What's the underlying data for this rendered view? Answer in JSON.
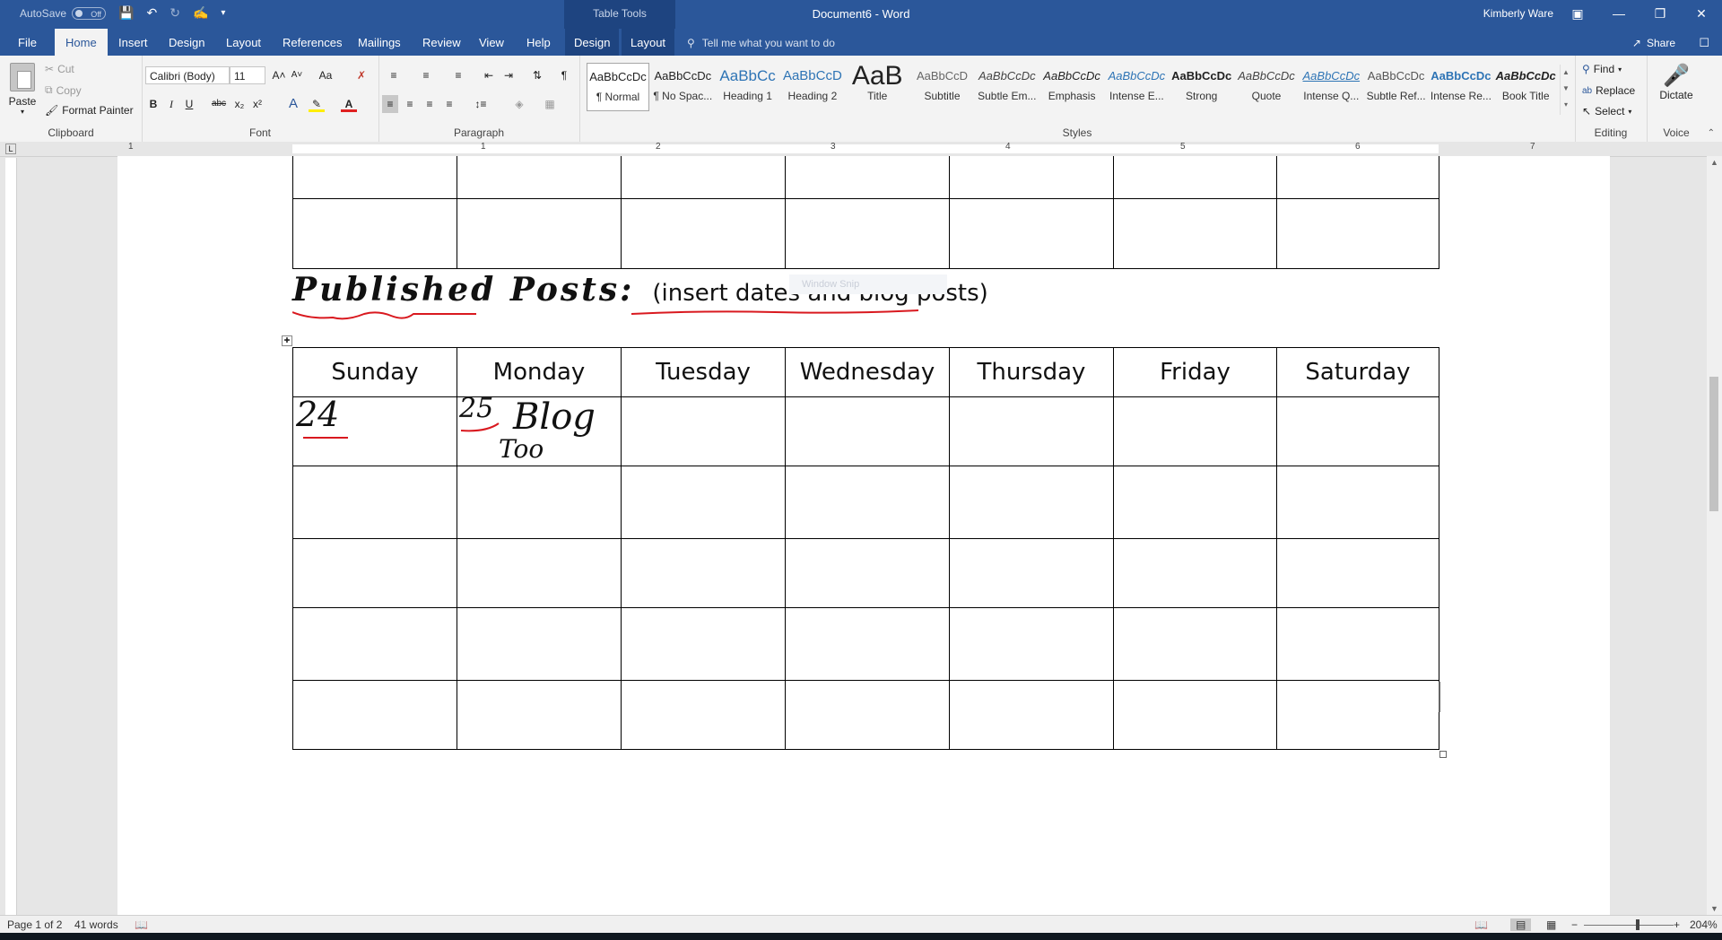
{
  "titlebar": {
    "autosave_label": "AutoSave",
    "autosave_state": "Off",
    "contextual_tab_group": "Table Tools",
    "document_title": "Document6  -  Word",
    "user_name": "Kimberly Ware"
  },
  "tabs": {
    "file": "File",
    "home": "Home",
    "insert": "Insert",
    "design": "Design",
    "layout": "Layout",
    "references": "References",
    "mailings": "Mailings",
    "review": "Review",
    "view": "View",
    "help": "Help",
    "table_design": "Design",
    "table_layout": "Layout",
    "tell_me": "Tell me what you want to do",
    "share": "Share"
  },
  "clipboard": {
    "paste": "Paste",
    "cut": "Cut",
    "copy": "Copy",
    "format_painter": "Format Painter",
    "group_label": "Clipboard"
  },
  "font": {
    "family": "Calibri (Body)",
    "size": "11",
    "bold": "B",
    "italic": "I",
    "underline": "U",
    "strike": "abc",
    "subscript": "x₂",
    "superscript": "x²",
    "change_case": "Aa",
    "group_label": "Font"
  },
  "paragraph": {
    "group_label": "Paragraph"
  },
  "styles": {
    "items": [
      {
        "sample": "AaBbCcDc",
        "name": "¶ Normal"
      },
      {
        "sample": "AaBbCcDc",
        "name": "¶ No Spac..."
      },
      {
        "sample": "AaBbCc",
        "name": "Heading 1"
      },
      {
        "sample": "AaBbCcD",
        "name": "Heading 2"
      },
      {
        "sample": "AaB",
        "name": "Title"
      },
      {
        "sample": "AaBbCcD",
        "name": "Subtitle"
      },
      {
        "sample": "AaBbCcDc",
        "name": "Subtle Em..."
      },
      {
        "sample": "AaBbCcDc",
        "name": "Emphasis"
      },
      {
        "sample": "AaBbCcDc",
        "name": "Intense E..."
      },
      {
        "sample": "AaBbCcDc",
        "name": "Strong"
      },
      {
        "sample": "AaBbCcDc",
        "name": "Quote"
      },
      {
        "sample": "AaBbCcDc",
        "name": "Intense Q..."
      },
      {
        "sample": "AaBbCcDc",
        "name": "Subtle Ref..."
      },
      {
        "sample": "AaBbCcDc",
        "name": "Intense Re..."
      },
      {
        "sample": "AaBbCcDc",
        "name": "Book Title"
      }
    ],
    "group_label": "Styles"
  },
  "editing": {
    "find": "Find",
    "replace": "Replace",
    "select": "Select",
    "group_label": "Editing"
  },
  "voice": {
    "dictate": "Dictate",
    "group_label": "Voice"
  },
  "ruler": {
    "numbers": [
      "1",
      "1",
      "2",
      "3",
      "4",
      "5",
      "6",
      "7"
    ]
  },
  "document": {
    "heading": "Published Posts:",
    "heading_note": "(insert dates and blog posts)",
    "window_snip": "Window Snip",
    "days": [
      "Sunday",
      "Monday",
      "Tuesday",
      "Wednesday",
      "Thursday",
      "Friday",
      "Saturday"
    ],
    "handwriting": {
      "sunday_date": "24",
      "monday_date": "25",
      "monday_note_1": "Blog",
      "monday_note_2": "Too"
    }
  },
  "status": {
    "page": "Page 1 of 2",
    "words": "41 words",
    "zoom": "204%"
  },
  "colors": {
    "word_blue": "#2b579a",
    "dark_blue": "#1e4480",
    "ink_red": "#d9191f"
  }
}
